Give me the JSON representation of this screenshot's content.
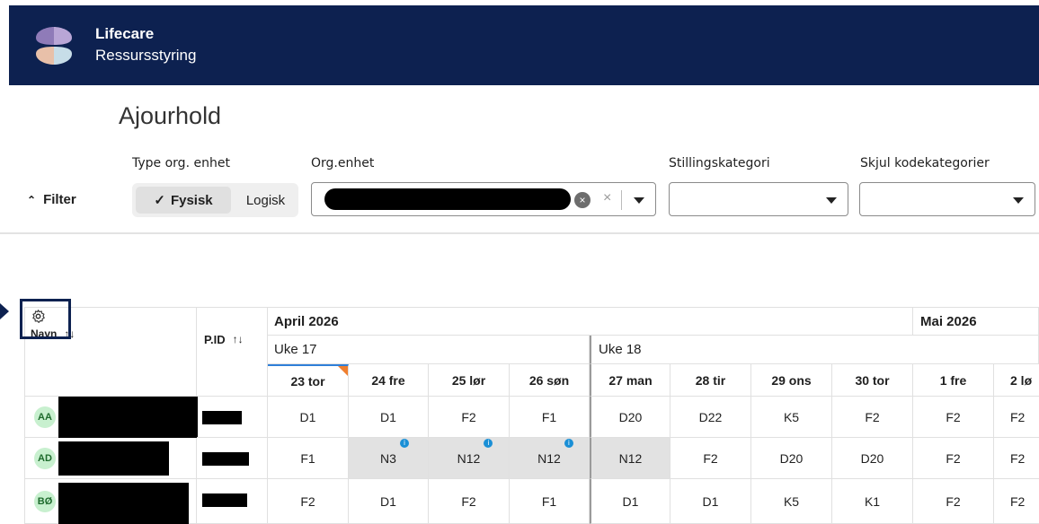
{
  "app": {
    "brand_line1": "Lifecare",
    "brand_line2": "Ressursstyring"
  },
  "page": {
    "title": "Ajourhold"
  },
  "filters": {
    "toggle_label": "Filter",
    "type_label": "Type org. enhet",
    "type_options": [
      "Fysisk",
      "Logisk"
    ],
    "type_selected": "Fysisk",
    "org_label": "Org.enhet",
    "stilling_label": "Stillingskategori",
    "skjul_label": "Skjul kodekategorier"
  },
  "grid": {
    "col_name": "Navn",
    "col_pid": "P.ID",
    "months": [
      "April 2026",
      "Mai 2026"
    ],
    "weeks": [
      "Uke 17",
      "Uke 18"
    ],
    "days": [
      "23 tor",
      "24 fre",
      "25 lør",
      "26 søn",
      "27 man",
      "28 tir",
      "29 ons",
      "30 tor",
      "1 fre",
      "2 lø"
    ],
    "rows": [
      {
        "initials": "AA",
        "shifts": [
          "D1",
          "D1",
          "F2",
          "F1",
          "D20",
          "D22",
          "K5",
          "F2",
          "F2",
          "F2"
        ]
      },
      {
        "initials": "AD",
        "shifts": [
          "F1",
          "N3",
          "N12",
          "N12",
          "N12",
          "F2",
          "D20",
          "D20",
          "F2",
          "F2"
        ]
      },
      {
        "initials": "BØ",
        "shifts": [
          "F2",
          "D1",
          "F2",
          "F1",
          "D1",
          "D1",
          "K5",
          "K1",
          "F2",
          "F2"
        ]
      }
    ]
  },
  "colors": {
    "navy": "#0d2150",
    "avatar_bg": "#c8f0cf",
    "info_dot": "#1a8fd6",
    "today_marker": "#2f7fd8",
    "weekend_flag": "#f07f2f"
  }
}
